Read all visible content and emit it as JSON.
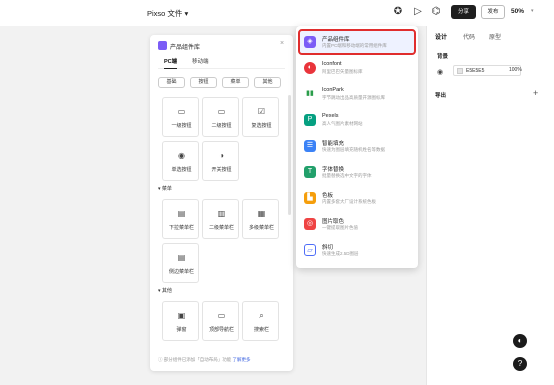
{
  "topbar": {
    "doc_title": "Pixso 文件 ▾",
    "share_label": "分享",
    "publish_label": "发布",
    "zoom": "50%"
  },
  "library": {
    "title": "产品组件库",
    "tabs": [
      "PC端",
      "移动端"
    ],
    "chips": [
      "基础",
      "按钮",
      "菜单",
      "其他"
    ],
    "basic_items": [
      {
        "icon": "button-icon",
        "label": "一级按钮"
      },
      {
        "icon": "button-icon",
        "label": "二级按钮"
      },
      {
        "icon": "checkbox-icon",
        "label": "复选按钮"
      },
      {
        "icon": "radio-icon",
        "label": "单选按钮"
      },
      {
        "icon": "toggle-icon",
        "label": "开关按钮"
      }
    ],
    "menu_section": "菜单",
    "menu_items": [
      {
        "icon": "dropdown-menu-icon",
        "label": "下拉菜单栏"
      },
      {
        "icon": "submenu-icon",
        "label": "二级菜单栏"
      },
      {
        "icon": "multi-menu-icon",
        "label": "多级菜单栏"
      },
      {
        "icon": "side-menu-icon",
        "label": "侧边菜单栏"
      }
    ],
    "other_section": "其他",
    "other_items": [
      {
        "icon": "popup-icon",
        "label": "弹窗"
      },
      {
        "icon": "top-nav-icon",
        "label": "顶部导航栏"
      },
      {
        "icon": "search-icon",
        "label": "搜索栏"
      }
    ],
    "footer_text": "部分组件已添加「自动布局」功能",
    "footer_link": "了解更多"
  },
  "plugins": [
    {
      "name": "产品组件库",
      "desc": "内置PC端和移动端的常用组件库",
      "icon": "library-icon",
      "color": "#7b5cf6",
      "selected": true
    },
    {
      "name": "Iconfont",
      "desc": "阿里巴巴矢量图标库",
      "icon": "iconfont-icon",
      "color": "#e9343b"
    },
    {
      "name": "IconPark",
      "desc": "字节跳动出品高质量开源图标库",
      "icon": "iconpark-icon",
      "color": "#2a9d4a"
    },
    {
      "name": "Pexels",
      "desc": "高人气图片素材网站",
      "icon": "pexels-icon",
      "color": "#05a081"
    },
    {
      "name": "智能填充",
      "desc": "快速为图层填充随机姓名等数据",
      "icon": "autofill-icon",
      "color": "#3b82f6"
    },
    {
      "name": "字体替换",
      "desc": "批量替换选中文字的字体",
      "icon": "font-replace-icon",
      "color": "#22a06b"
    },
    {
      "name": "色板",
      "desc": "内置多套大厂设计系统色板",
      "icon": "palette-icon",
      "color": "#f59e0b"
    },
    {
      "name": "图片取色",
      "desc": "一键提取图片色值",
      "icon": "color-picker-icon",
      "color": "#ef4444"
    },
    {
      "name": "斜切",
      "desc": "快速生成2.5D图层",
      "icon": "skew-icon",
      "color": "#4f6ef7"
    }
  ],
  "right_panel": {
    "tabs": [
      "设计",
      "代码",
      "原型"
    ],
    "background_label": "背景",
    "bg_hex": "E5E5E5",
    "bg_opacity": "100%",
    "export_label": "导出"
  }
}
